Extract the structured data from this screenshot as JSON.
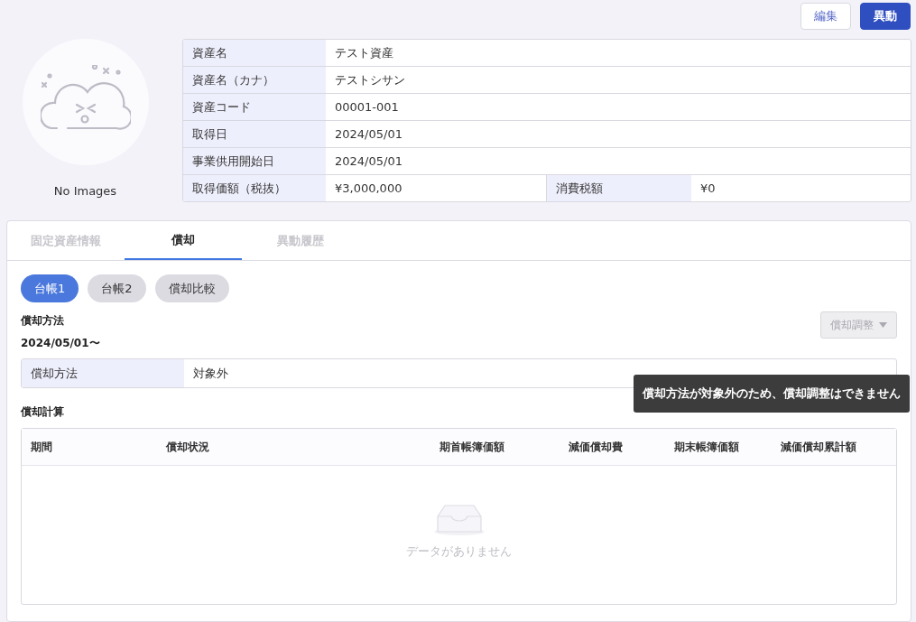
{
  "header_buttons": [
    {
      "label": "編集",
      "kind": "secondary"
    },
    {
      "label": "異動",
      "kind": "primary"
    }
  ],
  "image": {
    "caption": "No Images"
  },
  "asset_info": {
    "rows": [
      {
        "cells": [
          {
            "label": "資産名",
            "value": "テスト資産"
          }
        ]
      },
      {
        "cells": [
          {
            "label": "資産名（カナ）",
            "value": "テストシサン"
          }
        ]
      },
      {
        "cells": [
          {
            "label": "資産コード",
            "value": "00001-001"
          }
        ]
      },
      {
        "cells": [
          {
            "label": "取得日",
            "value": "2024/05/01"
          }
        ]
      },
      {
        "cells": [
          {
            "label": "事業供用開始日",
            "value": "2024/05/01"
          }
        ]
      },
      {
        "cells": [
          {
            "label": "取得価額（税抜）",
            "value": "¥3,000,000"
          },
          {
            "label": "消費税額",
            "value": "¥0"
          }
        ]
      }
    ]
  },
  "tabs": [
    {
      "label": "固定資産情報",
      "selected": false
    },
    {
      "label": "償却",
      "selected": true
    },
    {
      "label": "異動履歴",
      "selected": false
    }
  ],
  "ledger_tabs": [
    {
      "label": "台帳1",
      "selected": true
    },
    {
      "label": "台帳2",
      "selected": false
    },
    {
      "label": "償却比較",
      "selected": false
    }
  ],
  "depreciation_method": {
    "title": "償却方法",
    "period": "2024/05/01〜",
    "adjust_button": {
      "label": "償却調整",
      "disabled": true
    },
    "rows": [
      {
        "label": "償却方法",
        "value": "対象外"
      }
    ],
    "tooltip": "償却方法が対象外のため、償却調整はできません"
  },
  "calculation": {
    "title": "償却計算",
    "columns": [
      "期間",
      "償却状況",
      "期首帳簿価額",
      "減価償却費",
      "期末帳簿価額",
      "減価償却累計額"
    ],
    "empty_text": "データがありません"
  }
}
